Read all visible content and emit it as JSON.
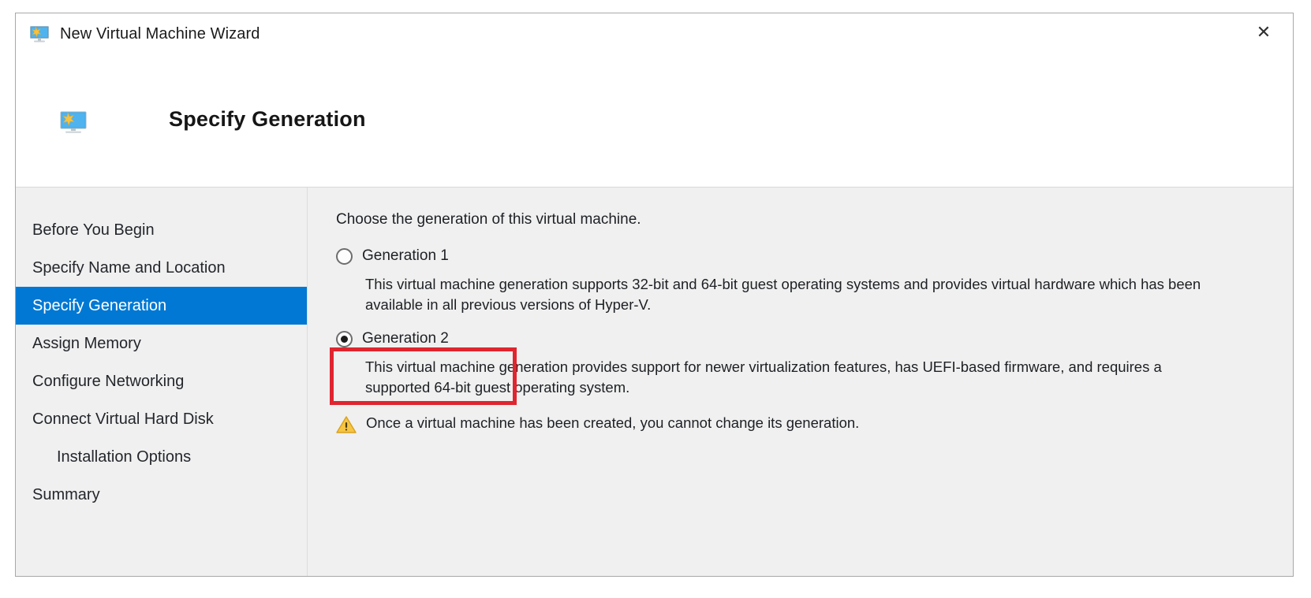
{
  "window": {
    "title": "New Virtual Machine Wizard",
    "title_icon": "virtual-machine-monitor-icon",
    "close_label": "✕"
  },
  "header": {
    "icon": "virtual-machine-monitor-icon",
    "title": "Specify Generation"
  },
  "sidebar": {
    "items": [
      {
        "label": "Before You Begin",
        "selected": false,
        "indent": false
      },
      {
        "label": "Specify Name and Location",
        "selected": false,
        "indent": false
      },
      {
        "label": "Specify Generation",
        "selected": true,
        "indent": false
      },
      {
        "label": "Assign Memory",
        "selected": false,
        "indent": false
      },
      {
        "label": "Configure Networking",
        "selected": false,
        "indent": false
      },
      {
        "label": "Connect Virtual Hard Disk",
        "selected": false,
        "indent": false
      },
      {
        "label": "Installation Options",
        "selected": false,
        "indent": true
      },
      {
        "label": "Summary",
        "selected": false,
        "indent": false
      }
    ]
  },
  "content": {
    "intro": "Choose the generation of this virtual machine.",
    "options": [
      {
        "label": "Generation 1",
        "selected": false,
        "description": "This virtual machine generation supports 32-bit and 64-bit guest operating systems and provides virtual hardware which has been available in all previous versions of Hyper-V."
      },
      {
        "label": "Generation 2",
        "selected": true,
        "description": "This virtual machine generation provides support for newer virtualization features, has UEFI-based firmware, and requires a supported 64-bit guest operating system."
      }
    ],
    "warning": {
      "icon": "warning-triangle-icon",
      "text": "Once a virtual machine has been created, you cannot change its generation."
    }
  },
  "annotation": {
    "highlight_target": "Generation 2",
    "color": "#e0252f"
  },
  "colors": {
    "accent": "#0078d4",
    "dialog_background": "#f0f0f0",
    "title_background": "#ffffff",
    "text": "#1d2024",
    "highlight": "#e0252f",
    "warning": "#f0b323"
  }
}
